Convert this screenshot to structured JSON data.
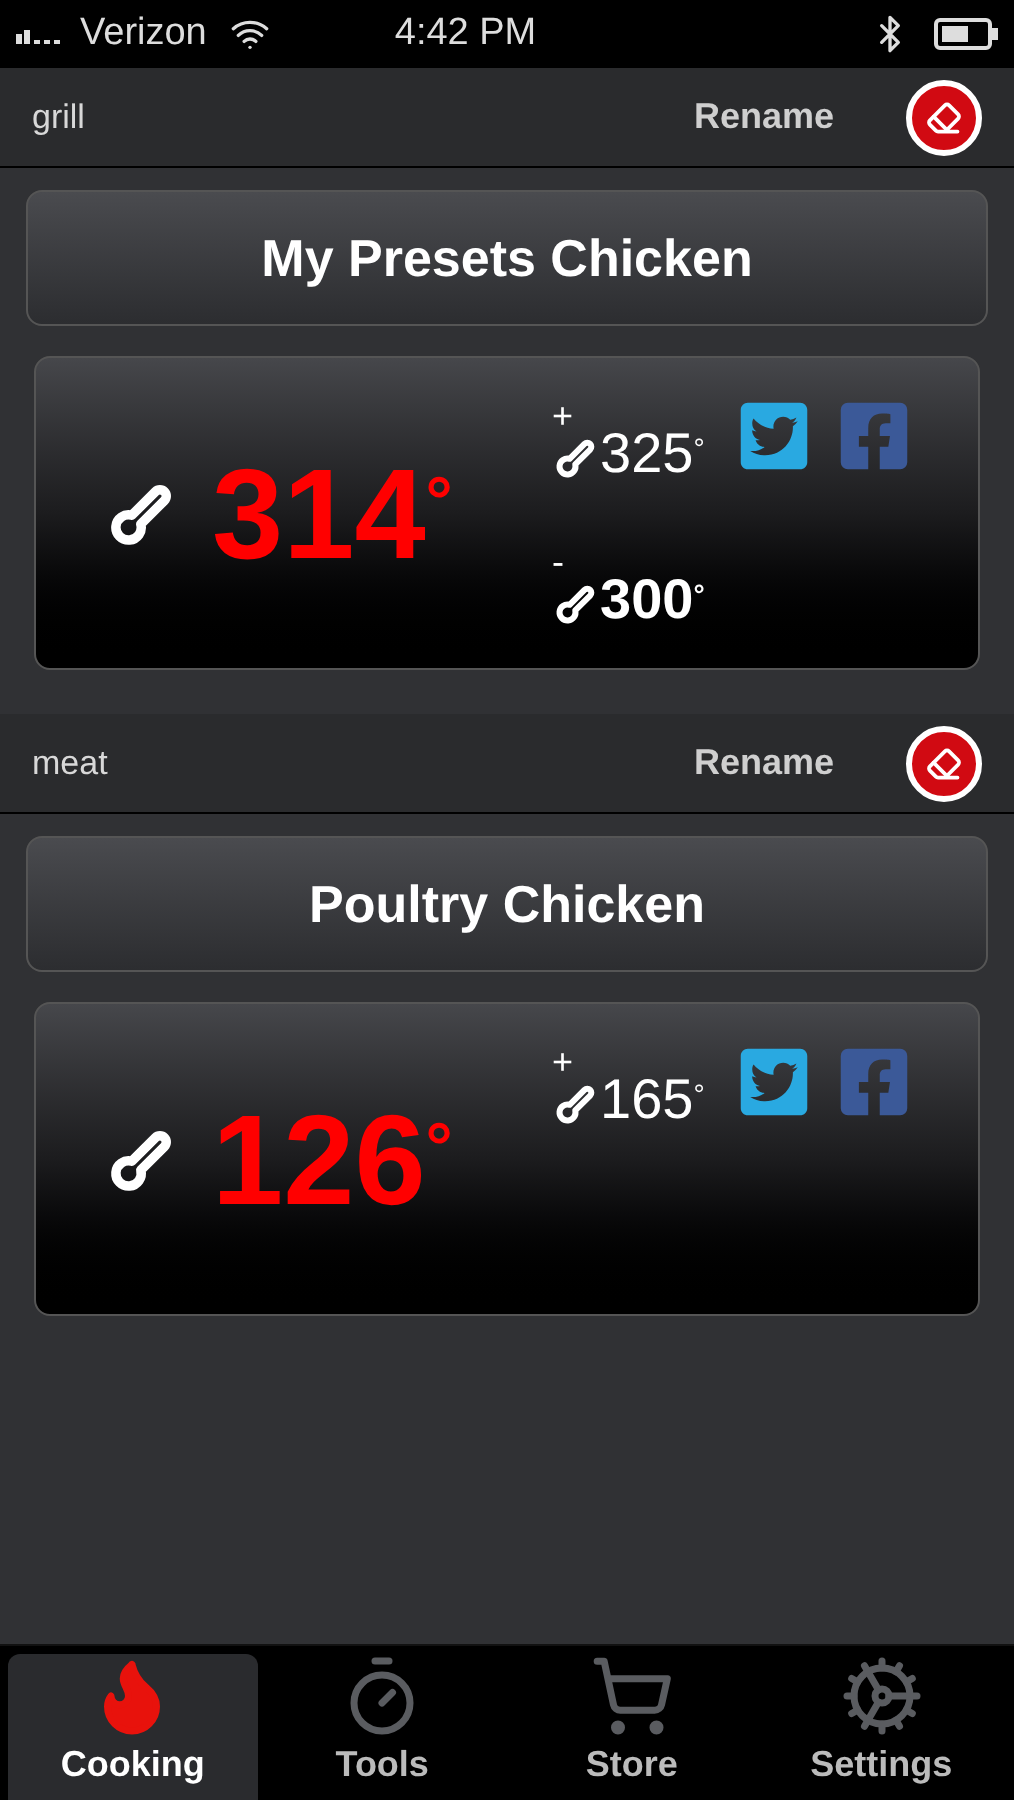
{
  "status_bar": {
    "carrier": "Verizon",
    "time": "4:42 PM"
  },
  "probes": [
    {
      "name": "grill",
      "rename": "Rename",
      "preset": "My Presets Chicken",
      "temperature": "314$^{°}$",
      "targets": [
        {
          "kind": "high",
          "sign": "+",
          "value": "325$^{°}$"
        },
        {
          "kind": "low",
          "sign": "-",
          "value": "300$^{°}$"
        }
      ]
    },
    {
      "name": "meat",
      "rename": "Rename",
      "preset": "Poultry Chicken",
      "temperature": "126$^{°}$",
      "targets": [
        {
          "kind": "high",
          "sign": "+",
          "value": "165$^{°}$"
        }
      ]
    }
  ],
  "tabs": [
    {
      "label": "Cooking",
      "kind": "cooking",
      "selected": true
    },
    {
      "label": "Tools",
      "kind": "tools",
      "selected": false
    },
    {
      "label": "Store",
      "kind": "store",
      "selected": false
    },
    {
      "label": "Settings",
      "kind": "settings",
      "selected": false
    }
  ]
}
